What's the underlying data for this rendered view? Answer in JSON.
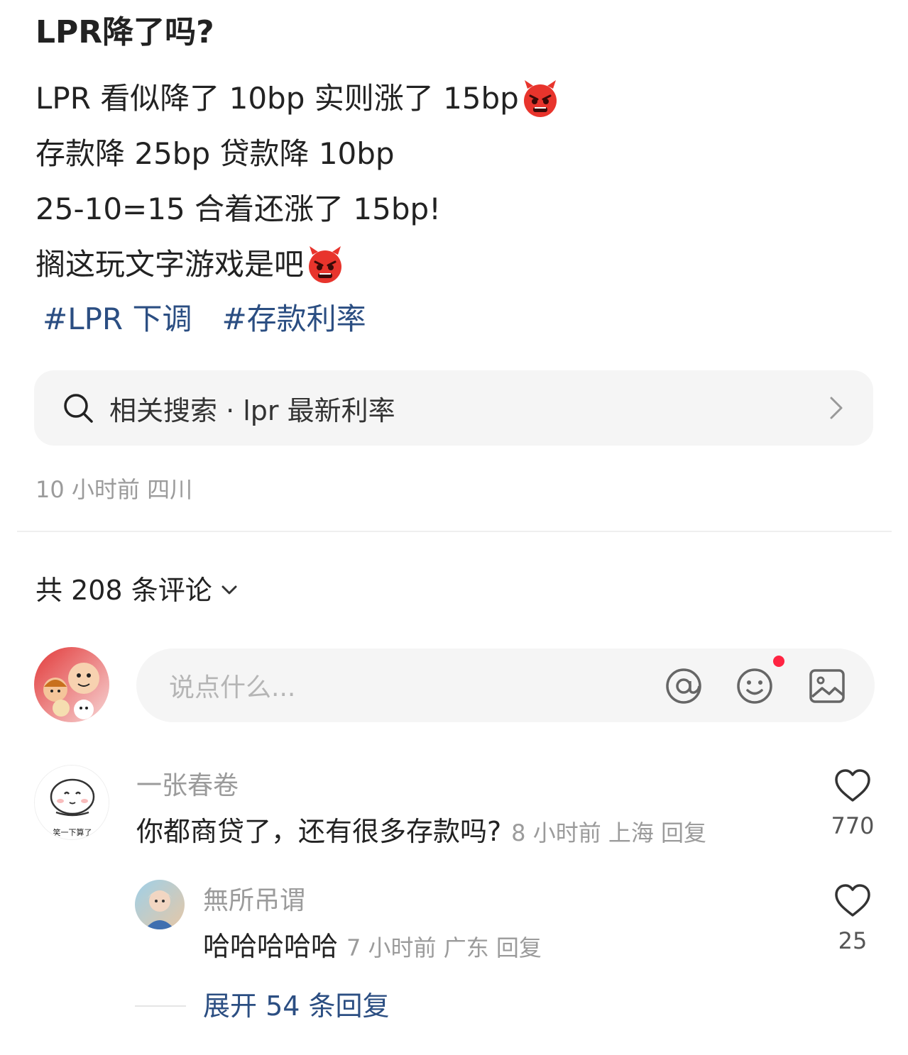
{
  "post": {
    "title": "LPR降了吗?",
    "lines": [
      {
        "text": "LPR 看似降了 10bp 实则涨了 15bp",
        "emoji": "angry-devil-emoji"
      },
      {
        "text": "存款降 25bp 贷款降 10bp",
        "emoji": ""
      },
      {
        "text": "25-10=15 合着还涨了 15bp!",
        "emoji": ""
      },
      {
        "text": "搁这玩文字游戏是吧",
        "emoji": "angry-devil-emoji"
      }
    ],
    "hashtags": [
      "#LPR 下调",
      "#存款利率"
    ],
    "related_search": "相关搜索 · lpr 最新利率",
    "meta": "10 小时前 四川"
  },
  "comments_header": {
    "count_label": "共 208 条评论"
  },
  "comment_input": {
    "placeholder": "说点什么..."
  },
  "comments": [
    {
      "author": "一张春卷",
      "avatar_caption": "笑一下算了",
      "text": "你都商贷了，还有很多存款吗?",
      "meta": "8 小时前 上海 回复",
      "likes": "770"
    },
    {
      "author": "無所吊谓",
      "text": "哈哈哈哈哈",
      "meta": "7 小时前 广东 回复",
      "likes": "25"
    }
  ],
  "expand_replies": "展开 54 条回复",
  "colors": {
    "link": "#2b4e82",
    "muted": "#9b9b9b",
    "notification": "#ff2442",
    "panel": "#f5f5f5"
  }
}
